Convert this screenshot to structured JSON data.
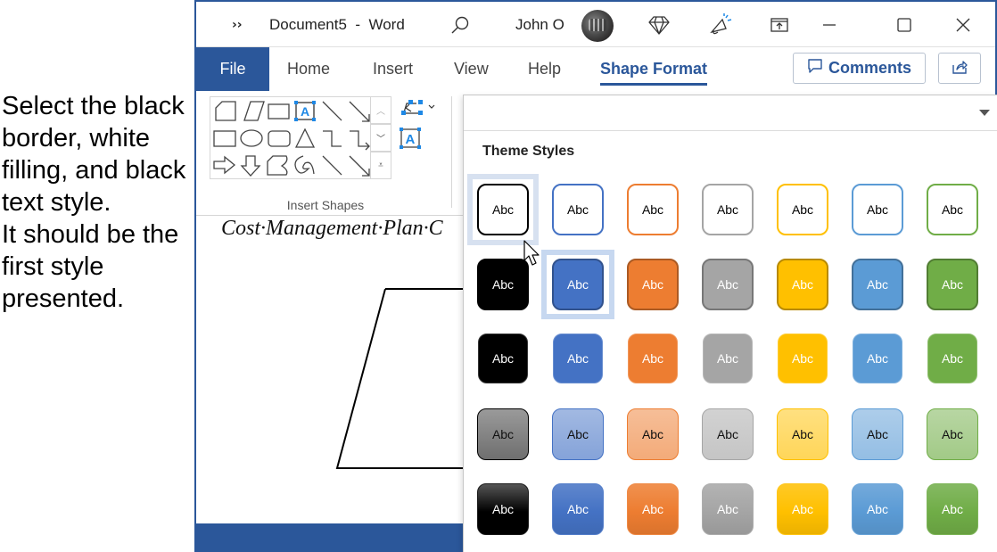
{
  "instruction": {
    "text": "Select the black border, white filling, and black text style.\nIt should be the first style presented."
  },
  "titlebar": {
    "more_icon": "chevrons-right-icon",
    "document_title": "Document5  -  Word",
    "search_icon": "search-icon",
    "user_name": "John O",
    "icons": [
      "diamond-icon",
      "megaphone-icon",
      "ribbon-display-icon",
      "minimize-icon",
      "maximize-icon",
      "close-icon"
    ]
  },
  "ribbon": {
    "tabs": [
      {
        "label": "File"
      },
      {
        "label": "Home"
      },
      {
        "label": "Insert"
      },
      {
        "label": "View"
      },
      {
        "label": "Help"
      },
      {
        "label": "Shape Format",
        "active": true
      }
    ],
    "comments_label": "Comments",
    "share_icon": "share-icon",
    "insert_shapes_group_label": "Insert Shapes",
    "shapes": [
      "snip-corner-rectangle",
      "parallelogram",
      "rectangle",
      "text-box",
      "line",
      "arrow-line",
      "rectangle",
      "oval",
      "rounded-rectangle",
      "triangle",
      "elbow-connector",
      "elbow-arrow-connector",
      "right-arrow",
      "down-arrow",
      "flowchart-shape",
      "scribble",
      "line",
      "arrow-line"
    ]
  },
  "document": {
    "heading": "Cost·Management·Plan·C"
  },
  "styles_panel": {
    "section_title": "Theme Styles",
    "tile_label": "Abc",
    "accent_colors": [
      "#000000",
      "#4472c4",
      "#ed7d31",
      "#a5a5a5",
      "#ffc000",
      "#5b9bd5",
      "#70ad47"
    ],
    "rows": [
      {
        "style": "colored-outline"
      },
      {
        "style": "colored-fill-dark-outline"
      },
      {
        "style": "colored-fill"
      },
      {
        "style": "light-gradient"
      },
      {
        "style": "intense-gradient"
      }
    ],
    "hovered_tile": {
      "row": 1,
      "col": 1
    },
    "selected_tile": {
      "row": 2,
      "col": 2
    }
  }
}
